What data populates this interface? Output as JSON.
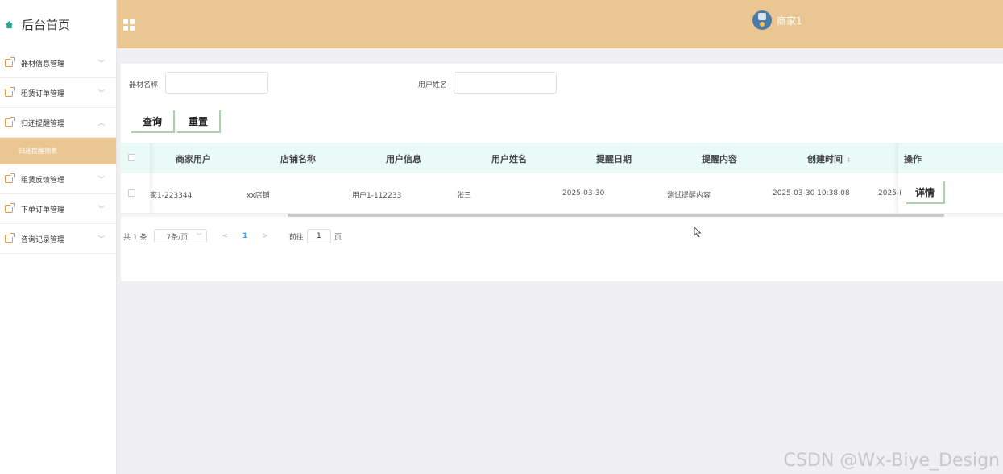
{
  "sidebar": {
    "brand": "后台首页",
    "items": [
      {
        "label": "器材信息管理"
      },
      {
        "label": "租赁订单管理"
      },
      {
        "label": "归还提醒管理",
        "expanded": true,
        "children": [
          {
            "label": "归还提醒列表",
            "active": true
          }
        ]
      },
      {
        "label": "租赁反馈管理"
      },
      {
        "label": "下单订单管理"
      },
      {
        "label": "咨询记录管理"
      }
    ]
  },
  "header": {
    "username": "商家1"
  },
  "search": {
    "field1_label": "器材名称",
    "field1_value": "",
    "field2_label": "用户姓名",
    "field2_value": "",
    "query_button": "查询",
    "reset_button": "重置"
  },
  "table": {
    "columns": [
      "商家用户",
      "店铺名称",
      "用户信息",
      "用户姓名",
      "提醒日期",
      "提醒内容",
      "创建时间",
      "操作"
    ],
    "sort_icon": "sort-icon",
    "rows": [
      {
        "merchant": "家1-223344",
        "shop": "xx店铺",
        "user_info": "用户1-112233",
        "user_name": "张三",
        "remind_date": "2025-03-30",
        "remind_content": "测试提醒内容",
        "created_at": "2025-03-30 10:38:08",
        "extra": "2025-(",
        "action": "详情"
      }
    ]
  },
  "pagination": {
    "total": "共 1 条",
    "page_size": "7条/页",
    "prev": "<",
    "current": "1",
    "next": ">",
    "goto_label": "前往",
    "goto_value": "1",
    "page_suffix": "页"
  },
  "watermark": "CSDN @Wx-Biye_Design",
  "colors": {
    "header_bg": "#eac692",
    "table_header_bg": "#e9faf7",
    "accent": "#409eff"
  }
}
